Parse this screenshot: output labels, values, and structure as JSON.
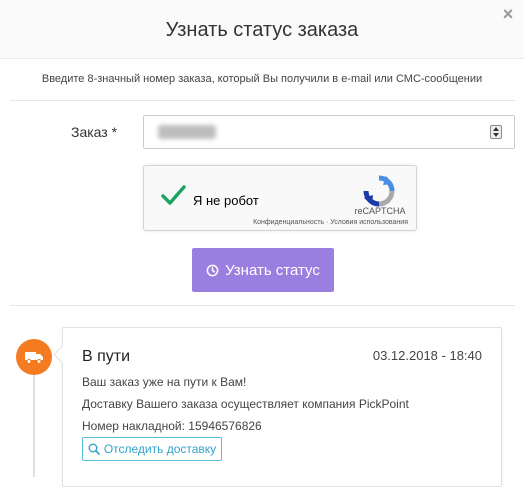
{
  "modal": {
    "title": "Узнать статус заказа",
    "close_label": "×"
  },
  "form": {
    "hint": "Введите 8-значный номер заказа, который Вы получили в e-mail или СМС-сообщении",
    "order_label": "Заказ *"
  },
  "captcha": {
    "label": "Я не робот",
    "brand": "reCAPTCHA",
    "links": "Конфиденциальность · Условия использования",
    "checked": true
  },
  "submit": {
    "label": "Узнать статус"
  },
  "timeline": {
    "status": "В пути",
    "date": "03.12.2018 - 18:40",
    "message": "Ваш заказ уже на пути к Вам!",
    "carrier": "Доставку Вашего заказа осуществляет компания PickPoint",
    "waybill": "Номер накладной: 15946576826",
    "track_label": "Отследить доставку",
    "icon": "truck-icon"
  },
  "colors": {
    "accent": "#9b7fe0",
    "status_icon": "#f47b20",
    "track_border": "#5bc0de",
    "check": "#1ea362"
  }
}
